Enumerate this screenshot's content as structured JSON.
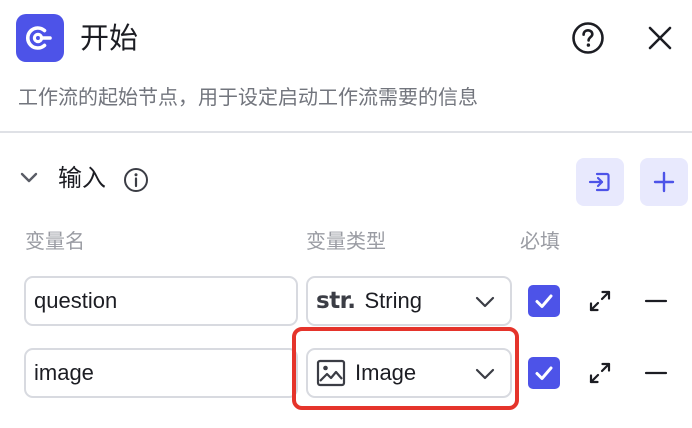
{
  "header": {
    "title": "开始",
    "description": "工作流的起始节点，用于设定启动工作流需要的信息",
    "node_icon": "start-node-icon",
    "help_icon": "question-circle-icon",
    "close_icon": "close-icon"
  },
  "section": {
    "title": "输入",
    "info_icon": "info-circle-icon",
    "import_icon": "import-icon",
    "add_icon": "plus-icon"
  },
  "columns": {
    "name": "变量名",
    "type": "变量类型",
    "required": "必填"
  },
  "rows": [
    {
      "name": "question",
      "type_label": "String",
      "type_glyph": "str.",
      "type_icon": "string-type-icon",
      "required": true
    },
    {
      "name": "image",
      "type_label": "Image",
      "type_icon": "image-type-icon",
      "required": true
    }
  ],
  "colors": {
    "accent": "#4d53e8",
    "accent_light": "#e8e9fd",
    "highlight": "#e5342b"
  }
}
